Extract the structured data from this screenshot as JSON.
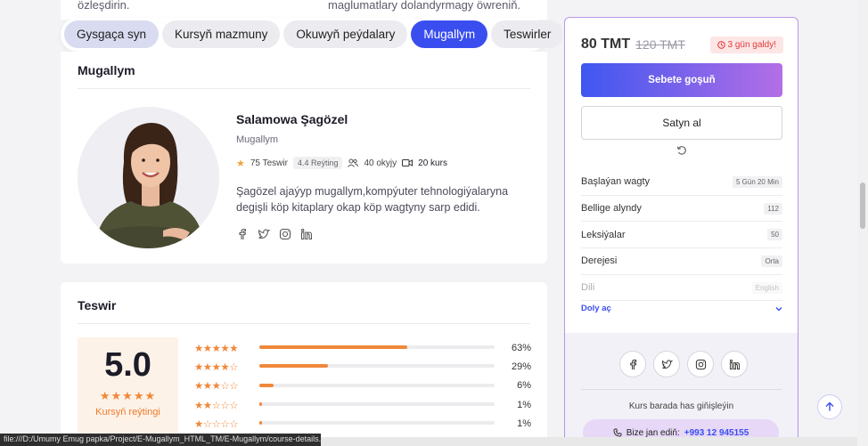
{
  "intro_fragment": {
    "left_text": "özleşdirin.",
    "right_text": "maglumatlary dolandyrmagy öwreniň."
  },
  "tabs": [
    {
      "label": "Gysgaça syn",
      "state": "overview"
    },
    {
      "label": "Kursyň mazmuny",
      "state": ""
    },
    {
      "label": "Okuwyň peýdalary",
      "state": ""
    },
    {
      "label": "Mugallym",
      "state": "active"
    },
    {
      "label": "Teswirler",
      "state": ""
    }
  ],
  "instructor": {
    "section_title": "Mugallym",
    "name": "Salamowa Şagözel",
    "role": "Mugallym",
    "reviews": "75 Teswir",
    "rating": "4.4 Reýting",
    "students": "40 okyjy",
    "courses": "20 kurs",
    "bio": "Şagözel ajaýyp mugallym,kompýuter tehnologiýalaryna degişli köp kitaplary okap köp wagtyny sarp edidi."
  },
  "review": {
    "section_title": "Teswir",
    "score": "5.0",
    "score_label": "Kursyň reýtingi",
    "rows": [
      {
        "stars": 5,
        "percent": 63,
        "label": "63%"
      },
      {
        "stars": 4,
        "percent": 29,
        "label": "29%"
      },
      {
        "stars": 3,
        "percent": 6,
        "label": "6%"
      },
      {
        "stars": 2,
        "percent": 1,
        "label": "1%"
      },
      {
        "stars": 1,
        "percent": 1,
        "label": "1%"
      }
    ]
  },
  "sidebar": {
    "price": "80 TMT",
    "old_price": "120 TMT",
    "days_left": "3 gün galdy!",
    "cart_button": "Sebete goşuň",
    "buy_button": "Satyn al",
    "info": [
      {
        "label": "Başlaýan wagty",
        "value": "5 Gün 20 Min"
      },
      {
        "label": "Bellige alyndy",
        "value": "112"
      },
      {
        "label": "Leksiýalar",
        "value": "50"
      },
      {
        "label": "Derejesi",
        "value": "Orta"
      },
      {
        "label": "Dili",
        "value": "English"
      }
    ],
    "more_label": "Doly aç",
    "share_text": "Kurs barada has giňişleýin",
    "contact_label": "Bize jan ediň:",
    "contact_phone": "+993 12 945155"
  },
  "status_url": "file:///D:/Umumy Emug papka/Project/E-Mugallym_HTML_TM/E-Mugallym/course-details.html#overview",
  "colors": {
    "accent": "#3a4ef0",
    "star": "#f0883a",
    "alert": "#e53a3a",
    "sidebar_border": "#b995e8"
  }
}
